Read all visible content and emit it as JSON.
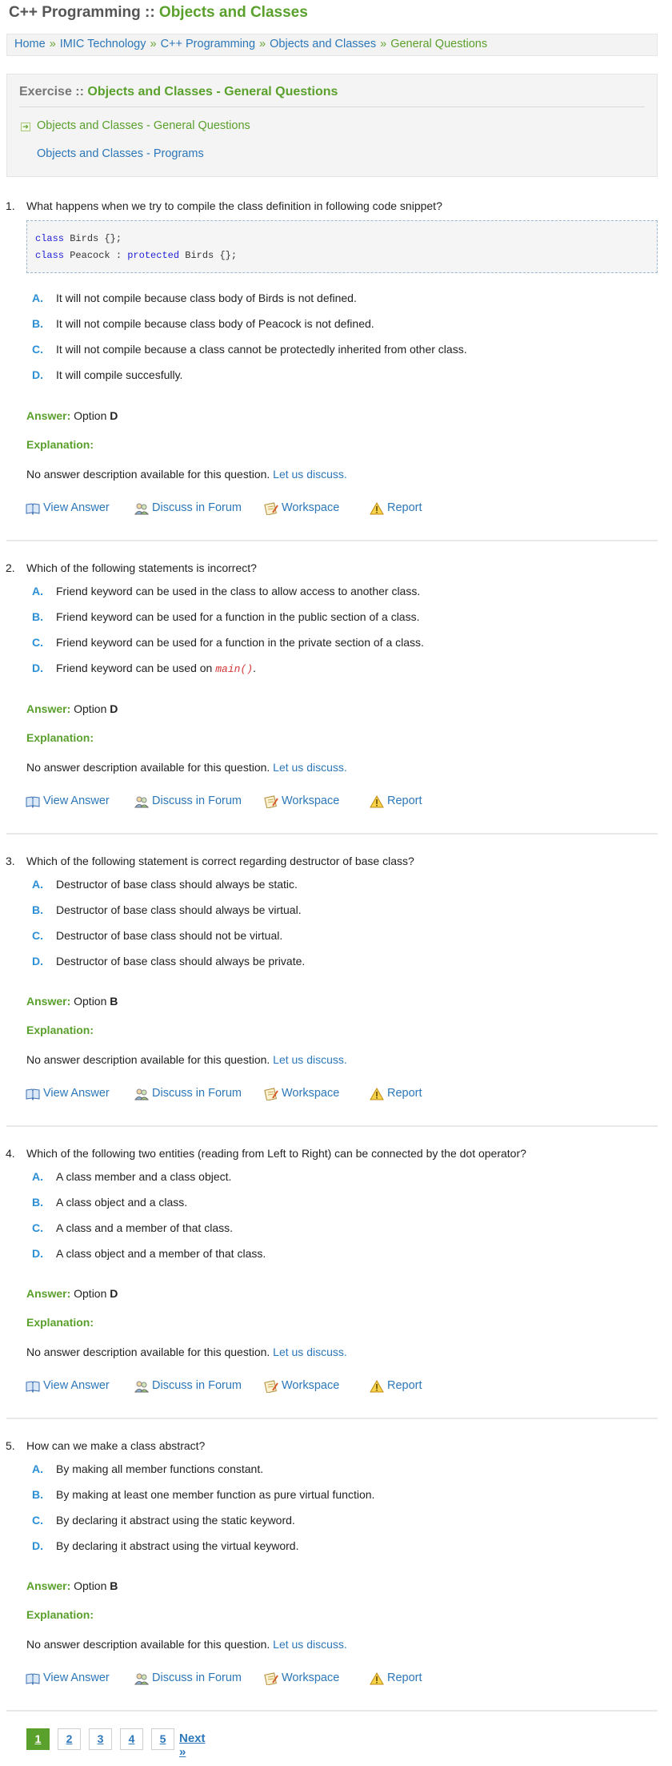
{
  "header": {
    "title_prefix": "C++ Programming :: ",
    "title_highlight": "Objects and Classes"
  },
  "breadcrumb": {
    "items": [
      "Home",
      "IMIC Technology",
      "C++ Programming",
      "Objects and Classes"
    ],
    "current": "General Questions",
    "separator": "»"
  },
  "exercise": {
    "title_prefix": "Exercise :: ",
    "title_highlight": "Objects and Classes - General Questions",
    "links": [
      "Objects and Classes - General Questions",
      "Objects and Classes - Programs"
    ]
  },
  "actions": {
    "view_answer": "View Answer",
    "discuss": "Discuss in Forum",
    "workspace": "Workspace",
    "report": "Report"
  },
  "labels": {
    "answer": "Answer:",
    "option_word": "Option",
    "explanation": "Explanation:",
    "no_desc": "No answer description available for this question.",
    "discuss_link": "Let us discuss."
  },
  "questions": [
    {
      "number": "1.",
      "text": "What happens when we try to compile the class definition in following code snippet?",
      "code": {
        "line1_kw": "class",
        "line1_rest": " Birds {};",
        "line2_kw1": "class",
        "line2_mid": " Peacock : ",
        "line2_kw2": "protected",
        "line2_rest": " Birds {};"
      },
      "options": [
        {
          "letter": "A.",
          "text": "It will not compile because class body of Birds is not defined."
        },
        {
          "letter": "B.",
          "text": "It will not compile because class body of Peacock is not defined."
        },
        {
          "letter": "C.",
          "text": "It will not compile because a class cannot be protectedly inherited from other class."
        },
        {
          "letter": "D.",
          "text": "It will compile succesfully."
        }
      ],
      "answer": "D"
    },
    {
      "number": "2.",
      "text": "Which of the following statements is incorrect?",
      "options": [
        {
          "letter": "A.",
          "text": "Friend keyword can be used in the class to allow access to another class."
        },
        {
          "letter": "B.",
          "text": "Friend keyword can be used for a function in the public section of a class."
        },
        {
          "letter": "C.",
          "text": "Friend keyword can be used for a function in the private section of a class."
        },
        {
          "letter": "D.",
          "text": "Friend keyword can be used on ",
          "code": "main()",
          "suffix": "."
        }
      ],
      "answer": "D"
    },
    {
      "number": "3.",
      "text": "Which of the following statement is correct regarding destructor of base class?",
      "options": [
        {
          "letter": "A.",
          "text": "Destructor of base class should always be static."
        },
        {
          "letter": "B.",
          "text": "Destructor of base class should always be virtual."
        },
        {
          "letter": "C.",
          "text": "Destructor of base class should not be virtual."
        },
        {
          "letter": "D.",
          "text": "Destructor of base class should always be private."
        }
      ],
      "answer": "B"
    },
    {
      "number": "4.",
      "text": "Which of the following two entities (reading from Left to Right) can be connected by the dot operator?",
      "options": [
        {
          "letter": "A.",
          "text": "A class member and a class object."
        },
        {
          "letter": "B.",
          "text": "A class object and a class."
        },
        {
          "letter": "C.",
          "text": "A class and a member of that class."
        },
        {
          "letter": "D.",
          "text": "A class object and a member of that class."
        }
      ],
      "answer": "D"
    },
    {
      "number": "5.",
      "text": "How can we make a class abstract?",
      "options": [
        {
          "letter": "A.",
          "text": "By making all member functions constant."
        },
        {
          "letter": "B.",
          "text": "By making at least one member function as pure virtual function."
        },
        {
          "letter": "C.",
          "text": "By declaring it abstract using the static keyword."
        },
        {
          "letter": "D.",
          "text": "By declaring it abstract using the virtual keyword."
        }
      ],
      "answer": "B"
    }
  ],
  "pagination": {
    "pages": [
      "1",
      "2",
      "3",
      "4",
      "5"
    ],
    "current": "1",
    "next": "Next »"
  }
}
